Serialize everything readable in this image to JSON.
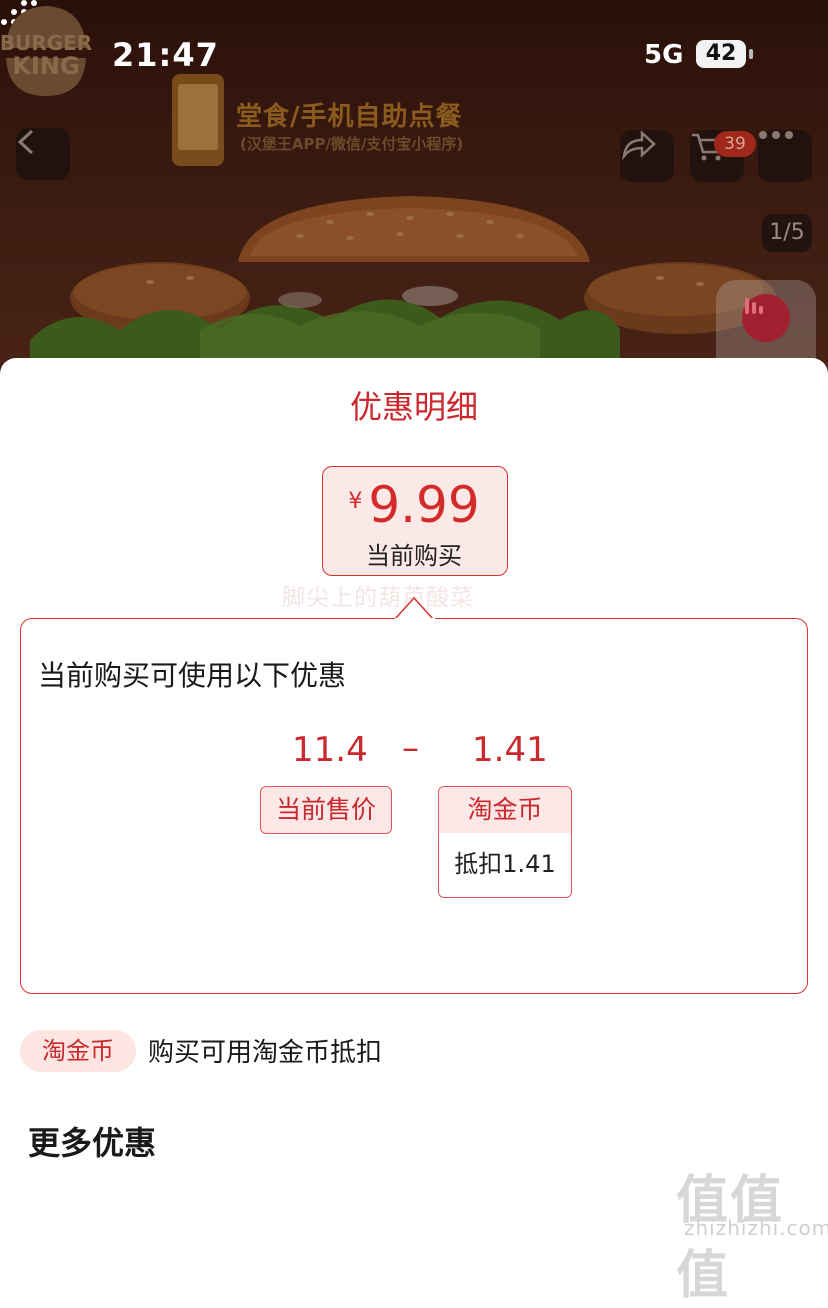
{
  "status_bar": {
    "time": "21:47",
    "network": "5G",
    "battery": "42"
  },
  "hero": {
    "brand_logo": [
      "BURGER",
      "KING"
    ],
    "promo_title": "堂食/手机自助点餐",
    "promo_subtitle": "(汉堡王APP/微信/支付宝小程序)",
    "cart_count": "39",
    "page_indicator": "1/5"
  },
  "sheet": {
    "title": "优惠明细",
    "price_currency": "¥",
    "price_value": "9.99",
    "price_label": "当前购买",
    "watermark": "脚尖上的葫芦酸菜",
    "card_heading": "当前购买可使用以下优惠",
    "current_price": "11.4",
    "minus_sign": "–",
    "discount_amount": "1.41",
    "current_price_label": "当前售价",
    "coin_label": "淘金币",
    "coin_deduct": "抵扣1.41",
    "coin_pill": "淘金币",
    "coin_pill_desc": "购买可用淘金币抵扣",
    "more_offers_title": "更多优惠"
  },
  "site_watermark": {
    "glyphs": "值值值",
    "url": "zhizhizhi.com"
  },
  "colors": {
    "accent_red": "#c9282d",
    "tag_bg": "#fbe7e6",
    "sheet_bg": "#ffffff"
  }
}
